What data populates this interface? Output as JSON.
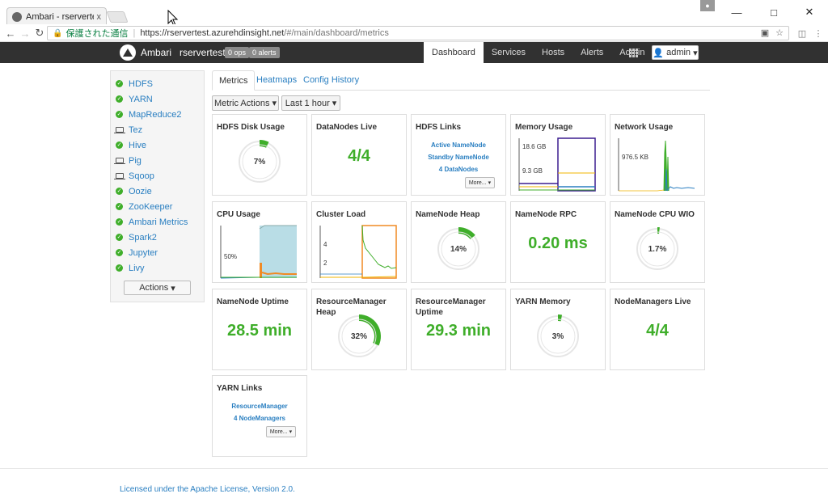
{
  "browser": {
    "tab_title": "Ambari - rservertest",
    "tab_close": "x",
    "window_minimize": "—",
    "window_maximize": "□",
    "window_close": "✕",
    "back": "←",
    "forward": "→",
    "reload": "↻",
    "secure_label": "保護された通信",
    "url_scheme": "https://",
    "url_host": "rservertest.azurehdinsight.net",
    "url_path": "/#/main/dashboard/metrics"
  },
  "topbar": {
    "brand": "Ambari",
    "cluster_name": "rservertest",
    "ops_badge": "0 ops",
    "alerts_badge": "0 alerts",
    "nav": [
      "Dashboard",
      "Services",
      "Hosts",
      "Alerts",
      "Admin"
    ],
    "active_nav": "Dashboard",
    "user": "admin"
  },
  "sidebar": {
    "services": [
      {
        "name": "HDFS",
        "status": "ok"
      },
      {
        "name": "YARN",
        "status": "ok"
      },
      {
        "name": "MapReduce2",
        "status": "ok"
      },
      {
        "name": "Tez",
        "status": "client"
      },
      {
        "name": "Hive",
        "status": "ok"
      },
      {
        "name": "Pig",
        "status": "client"
      },
      {
        "name": "Sqoop",
        "status": "client"
      },
      {
        "name": "Oozie",
        "status": "ok"
      },
      {
        "name": "ZooKeeper",
        "status": "ok"
      },
      {
        "name": "Ambari Metrics",
        "status": "ok"
      },
      {
        "name": "Spark2",
        "status": "ok"
      },
      {
        "name": "Jupyter",
        "status": "ok"
      },
      {
        "name": "Livy",
        "status": "ok"
      }
    ],
    "actions_label": "Actions"
  },
  "subtabs": [
    "Metrics",
    "Heatmaps",
    "Config History"
  ],
  "toolbar": {
    "metric_actions": "Metric Actions",
    "time_range": "Last 1 hour"
  },
  "widgets": {
    "hdfs_disk": {
      "title": "HDFS Disk Usage",
      "value": 7,
      "label": "7%"
    },
    "datanodes": {
      "title": "DataNodes Live",
      "value": "4/4"
    },
    "hdfs_links": {
      "title": "HDFS Links",
      "links": [
        "Active NameNode",
        "Standby NameNode",
        "4 DataNodes"
      ],
      "more": "More..."
    },
    "memory": {
      "title": "Memory Usage",
      "label_high": "18.6 GB",
      "label_low": "9.3 GB"
    },
    "network": {
      "title": "Network Usage",
      "label": "976.5 KB"
    },
    "cpu": {
      "title": "CPU Usage",
      "label": "50%"
    },
    "cluster_load": {
      "title": "Cluster Load",
      "label_high": "4",
      "label_low": "2"
    },
    "nn_heap": {
      "title": "NameNode Heap",
      "value": 14,
      "label": "14%"
    },
    "nn_rpc": {
      "title": "NameNode RPC",
      "value": "0.20 ms"
    },
    "nn_cpu": {
      "title": "NameNode CPU WIO",
      "value": 1.7,
      "label": "1.7%"
    },
    "nn_uptime": {
      "title": "NameNode Uptime",
      "value": "28.5 min"
    },
    "rm_heap": {
      "title": "ResourceManager Heap",
      "value": 32,
      "label": "32%"
    },
    "rm_uptime": {
      "title": "ResourceManager Uptime",
      "value": "29.3 min"
    },
    "yarn_memory": {
      "title": "YARN Memory",
      "value": 3,
      "label": "3%"
    },
    "nm_live": {
      "title": "NodeManagers Live",
      "value": "4/4"
    },
    "yarn_links": {
      "title": "YARN Links",
      "links": [
        "ResourceManager",
        "4 NodeManagers"
      ],
      "more": "More..."
    }
  },
  "footer": "Licensed under the Apache License, Version 2.0.",
  "colors": {
    "accent_green": "#3fae2a",
    "link_blue": "#2a7fc1",
    "topbar": "#313131"
  }
}
